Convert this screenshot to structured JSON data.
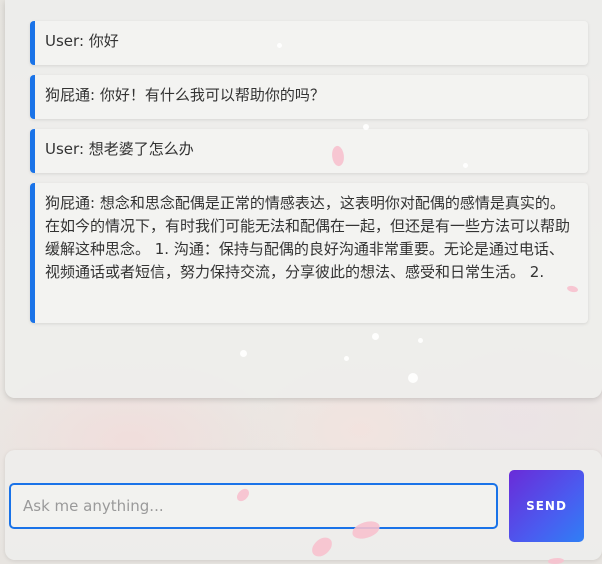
{
  "messages": [
    {
      "speaker": "User",
      "text": "你好"
    },
    {
      "speaker": "狗屁通",
      "text": "你好！有什么我可以帮助你的吗？"
    },
    {
      "speaker": "User",
      "text": "想老婆了怎么办"
    },
    {
      "speaker": "狗屁通",
      "text": "想念和思念配偶是正常的情感表达，这表明你对配偶的感情是真实的。在如今的情况下，有时我们可能无法和配偶在一起，但还是有一些方法可以帮助缓解这种思念。 1. 沟通：保持与配偶的良好沟通非常重要。无论是通过电话、视频通话或者短信，努力保持交流，分享彼此的想法、感受和日常生活。 2."
    }
  ],
  "input": {
    "placeholder": "Ask me anything...",
    "value": ""
  },
  "send_button": {
    "label": "SEND"
  },
  "colors": {
    "accent": "#1a73e8",
    "send_gradient_start": "#6a2bd8",
    "send_gradient_end": "#2f7ff5"
  }
}
